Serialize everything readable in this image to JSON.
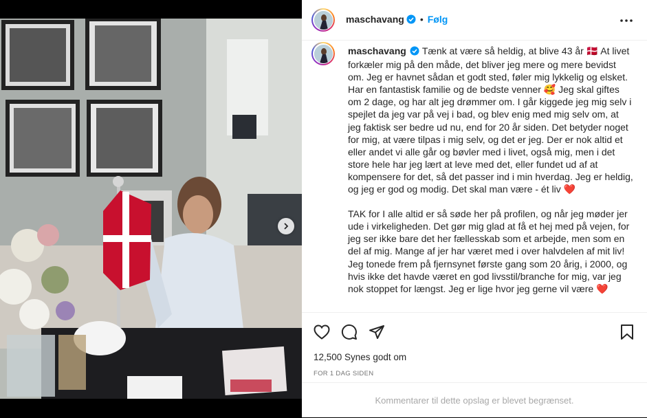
{
  "post": {
    "username": "maschavang",
    "follow_label": "Følg",
    "dot": "•"
  },
  "caption": {
    "username": "maschavang",
    "paragraph1": "Tænk at være så heldig, at blive 43 år 🇩🇰 At livet forkæler mig på den måde, det bliver jeg mere og mere bevidst om. Jeg er havnet sådan et godt sted, føler mig lykkelig og elsket. Har en fantastisk familie og de bedste venner 🥰 Jeg skal giftes om 2 dage, og har alt jeg drømmer om. I går kiggede jeg mig selv i spejlet da jeg var på vej i bad, og blev enig med mig selv om, at jeg faktisk ser bedre ud nu, end for 20 år siden. Det betyder noget for mig, at være tilpas i mig selv, og det er jeg. Der er nok altid et eller andet vi alle går og bøvler med i livet, også mig, men i det store hele har jeg lært at leve med det, eller fundet ud af at kompensere for det, så det passer ind i min hverdag. Jeg er heldig, og jeg er god og modig. Det skal man være - ét liv ❤️",
    "paragraph2": "TAK for I alle altid er så søde her på profilen, og når jeg møder jer ude i virkeligheden. Det gør mig glad at få et hej med på vejen, for jeg ser ikke bare det her fællesskab som et arbejde, men som en del af mig. Mange af jer har været med i over halvdelen af mit liv! Jeg tonede frem på fjernsynet første gang som 20 årig, i 2000, og hvis ikke det havde været en god livsstil/branche for mig, var jeg nok stoppet for længst. Jeg er lige hvor jeg gerne vil være ❤️"
  },
  "stats": {
    "likes": "12,500 Synes godt om",
    "date": "FOR 1 DAG SIDEN"
  },
  "comments_notice": "Kommentarer til dette opslag er blevet begrænset.",
  "icons": {
    "like": "heart-icon",
    "comment": "comment-icon",
    "share": "share-icon",
    "save": "bookmark-icon",
    "more": "more-horizontal-icon",
    "verified": "verified-badge-icon",
    "next": "chevron-right-icon"
  },
  "colors": {
    "accent": "#0095f6",
    "text": "#262626",
    "muted": "#737373"
  }
}
